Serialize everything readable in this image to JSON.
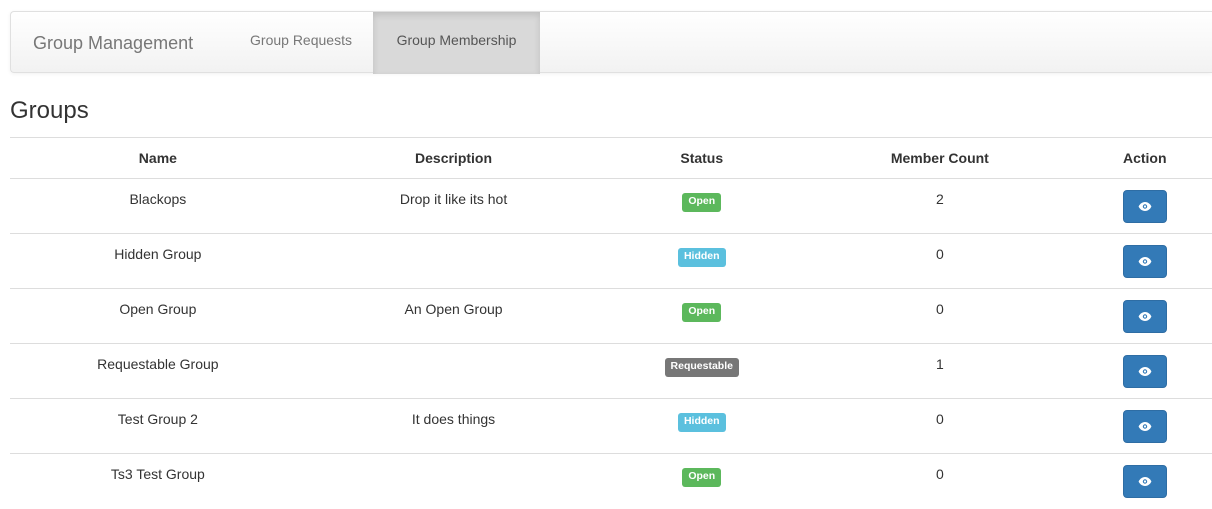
{
  "navbar": {
    "brand": "Group Management",
    "links": [
      {
        "label": "Group Requests",
        "active": false
      },
      {
        "label": "Group Membership",
        "active": true
      }
    ]
  },
  "page": {
    "title": "Groups"
  },
  "table": {
    "headers": {
      "name": "Name",
      "description": "Description",
      "status": "Status",
      "member_count": "Member Count",
      "action": "Action"
    },
    "rows": [
      {
        "name": "Blackops",
        "description": "Drop it like its hot",
        "status": "Open",
        "member_count": "2",
        "action_icon": "eye-icon"
      },
      {
        "name": "Hidden Group",
        "description": "",
        "status": "Hidden",
        "member_count": "0",
        "action_icon": "eye-icon"
      },
      {
        "name": "Open Group",
        "description": "An Open Group",
        "status": "Open",
        "member_count": "0",
        "action_icon": "eye-icon"
      },
      {
        "name": "Requestable Group",
        "description": "",
        "status": "Requestable",
        "member_count": "1",
        "action_icon": "eye-icon"
      },
      {
        "name": "Test Group 2",
        "description": "It does things",
        "status": "Hidden",
        "member_count": "0",
        "action_icon": "eye-icon"
      },
      {
        "name": "Ts3 Test Group",
        "description": "",
        "status": "Open",
        "member_count": "0",
        "action_icon": "eye-icon"
      }
    ]
  },
  "colors": {
    "open": "#5cb85c",
    "hidden": "#5bc0de",
    "requestable": "#777777",
    "primary_button": "#337ab7"
  }
}
